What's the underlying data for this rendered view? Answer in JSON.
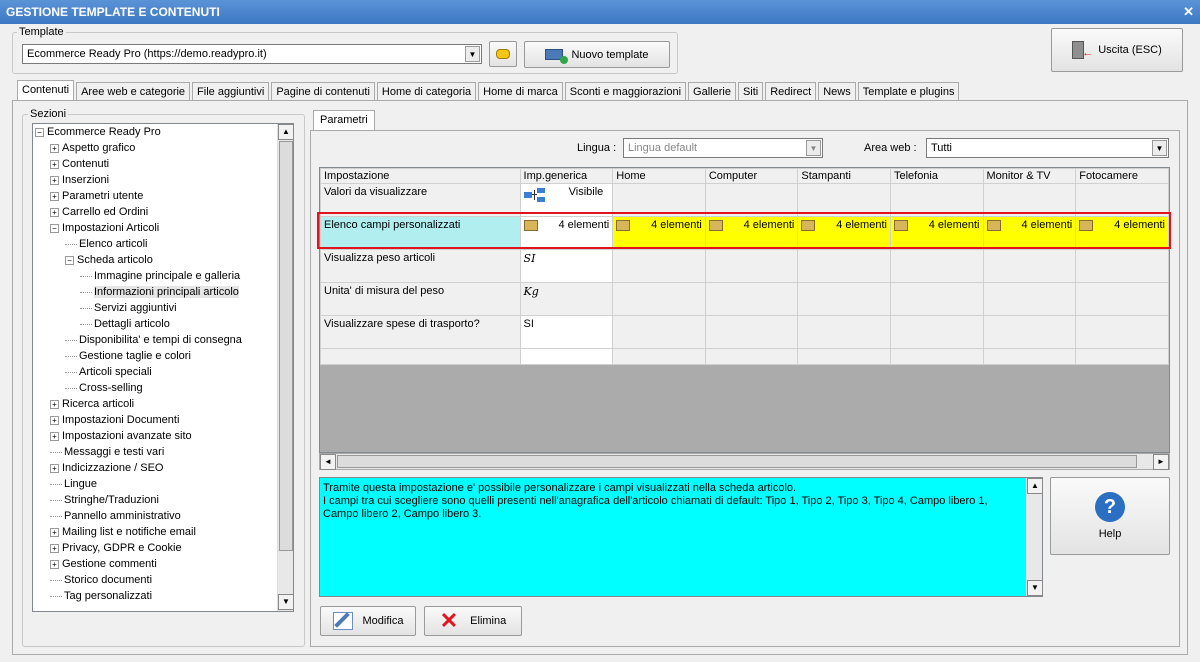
{
  "window": {
    "title": "GESTIONE TEMPLATE E CONTENUTI",
    "close": "✕"
  },
  "template": {
    "label": "Template",
    "value": "Ecommerce Ready Pro (https://demo.readypro.it)",
    "new_label": "Nuovo template"
  },
  "exit_label": "Uscita (ESC)",
  "tabs": [
    "Contenuti",
    "Aree web e categorie",
    "File aggiuntivi",
    "Pagine di contenuti",
    "Home di categoria",
    "Home di marca",
    "Sconti e maggiorazioni",
    "Gallerie",
    "Siti",
    "Redirect",
    "News",
    "Template e plugins"
  ],
  "sections_label": "Sezioni",
  "tree": [
    {
      "label": "Ecommerce Ready Pro",
      "level": 0,
      "exp": "−"
    },
    {
      "label": "Aspetto grafico",
      "level": 1,
      "exp": "+"
    },
    {
      "label": "Contenuti",
      "level": 1,
      "exp": "+"
    },
    {
      "label": "Inserzioni",
      "level": 1,
      "exp": "+"
    },
    {
      "label": "Parametri utente",
      "level": 1,
      "exp": "+"
    },
    {
      "label": "Carrello ed Ordini",
      "level": 1,
      "exp": "+"
    },
    {
      "label": "Impostazioni Articoli",
      "level": 1,
      "exp": "−"
    },
    {
      "label": "Elenco articoli",
      "level": 2,
      "exp": ""
    },
    {
      "label": "Scheda articolo",
      "level": 2,
      "exp": "−"
    },
    {
      "label": "Immagine principale e galleria",
      "level": 3,
      "exp": ""
    },
    {
      "label": "Informazioni principali articolo",
      "level": 3,
      "exp": "",
      "selected": true
    },
    {
      "label": "Servizi aggiuntivi",
      "level": 3,
      "exp": ""
    },
    {
      "label": "Dettagli articolo",
      "level": 3,
      "exp": ""
    },
    {
      "label": "Disponibilita' e tempi di consegna",
      "level": 2,
      "exp": ""
    },
    {
      "label": "Gestione taglie e colori",
      "level": 2,
      "exp": ""
    },
    {
      "label": "Articoli speciali",
      "level": 2,
      "exp": ""
    },
    {
      "label": "Cross-selling",
      "level": 2,
      "exp": ""
    },
    {
      "label": "Ricerca articoli",
      "level": 1,
      "exp": "+"
    },
    {
      "label": "Impostazioni Documenti",
      "level": 1,
      "exp": "+"
    },
    {
      "label": "Impostazioni avanzate sito",
      "level": 1,
      "exp": "+"
    },
    {
      "label": "Messaggi e testi vari",
      "level": 1,
      "exp": ""
    },
    {
      "label": "Indicizzazione / SEO",
      "level": 1,
      "exp": "+"
    },
    {
      "label": "Lingue",
      "level": 1,
      "exp": ""
    },
    {
      "label": "Stringhe/Traduzioni",
      "level": 1,
      "exp": ""
    },
    {
      "label": "Pannello amministrativo",
      "level": 1,
      "exp": ""
    },
    {
      "label": "Mailing list e notifiche email",
      "level": 1,
      "exp": "+"
    },
    {
      "label": "Privacy, GDPR e Cookie",
      "level": 1,
      "exp": "+"
    },
    {
      "label": "Gestione commenti",
      "level": 1,
      "exp": "+"
    },
    {
      "label": "Storico documenti",
      "level": 1,
      "exp": ""
    },
    {
      "label": "Tag personalizzati",
      "level": 1,
      "exp": ""
    }
  ],
  "params_tab": "Parametri",
  "lingua": {
    "label": "Lingua :",
    "value": "Lingua default"
  },
  "area": {
    "label": "Area web :",
    "value": "Tutti"
  },
  "grid": {
    "headers": [
      "Impostazione",
      "Imp.generica",
      "Home",
      "Computer",
      "Stampanti",
      "Telefonia",
      "Monitor & TV",
      "Fotocamere"
    ],
    "rows": [
      {
        "label": "Valori da visualizzare",
        "generic": "Visibile"
      },
      {
        "label": "Elenco campi personalizzati",
        "generic": "4 elementi",
        "others": [
          "4 elementi",
          "4 elementi",
          "4 elementi",
          "4 elementi",
          "4 elementi",
          "4 elementi"
        ]
      },
      {
        "label": "Visualizza peso articoli",
        "generic": "SI"
      },
      {
        "label": "Unita' di misura del peso",
        "generic": "Kg"
      },
      {
        "label": "Visualizzare spese di trasporto?",
        "generic": "SI"
      }
    ]
  },
  "description": "Tramite questa impostazione e' possibile personalizzare i campi visualizzati nella scheda articolo.\nI campi tra cui scegliere sono quelli presenti nell'anagrafica dell'articolo chiamati di default: Tipo 1, Tipo 2, Tipo 3, Tipo 4, Campo libero 1, Campo libero 2, Campo libero 3.",
  "help_label": "Help",
  "modifica_label": "Modifica",
  "elimina_label": "Elimina"
}
